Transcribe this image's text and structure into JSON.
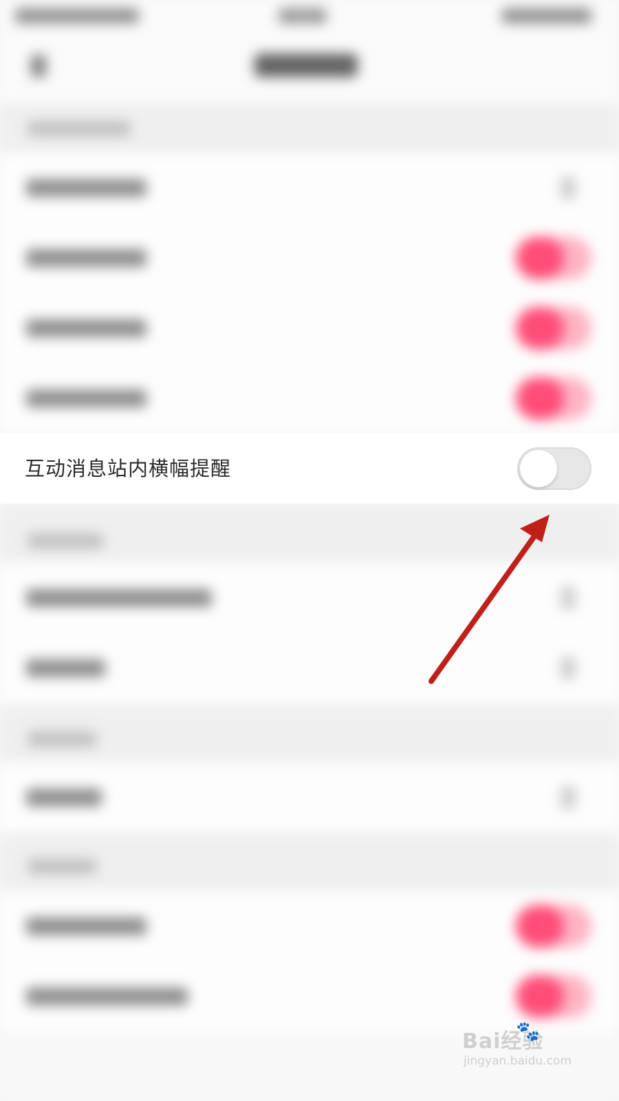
{
  "banner_setting": {
    "label": "互动消息站内横幅提醒",
    "enabled": false
  },
  "colors": {
    "accent_pink": "#ff4d78",
    "toggle_off": "#e6e6e6",
    "annotation_arrow": "#c0201a"
  },
  "watermark": {
    "logo": "Bai经验",
    "paw_icon": "baidu-paw-icon",
    "site": "jingyan.baidu.com"
  }
}
